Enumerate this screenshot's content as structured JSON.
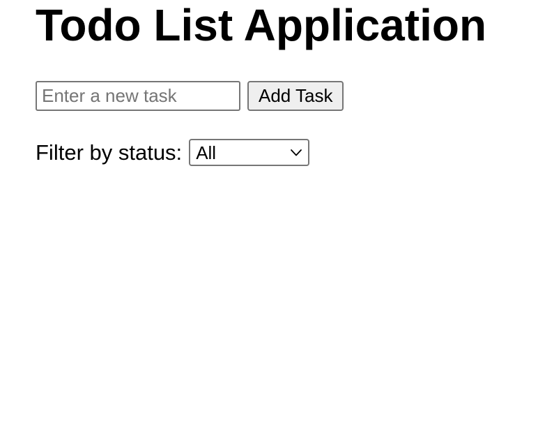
{
  "header": {
    "title": "Todo List Application"
  },
  "task_form": {
    "input_value": "",
    "input_placeholder": "Enter a new task",
    "add_button_label": "Add Task"
  },
  "filter": {
    "label": "Filter by status:",
    "selected_value": "All",
    "dropdown_icon": "chevron-down-icon"
  },
  "tasks": []
}
